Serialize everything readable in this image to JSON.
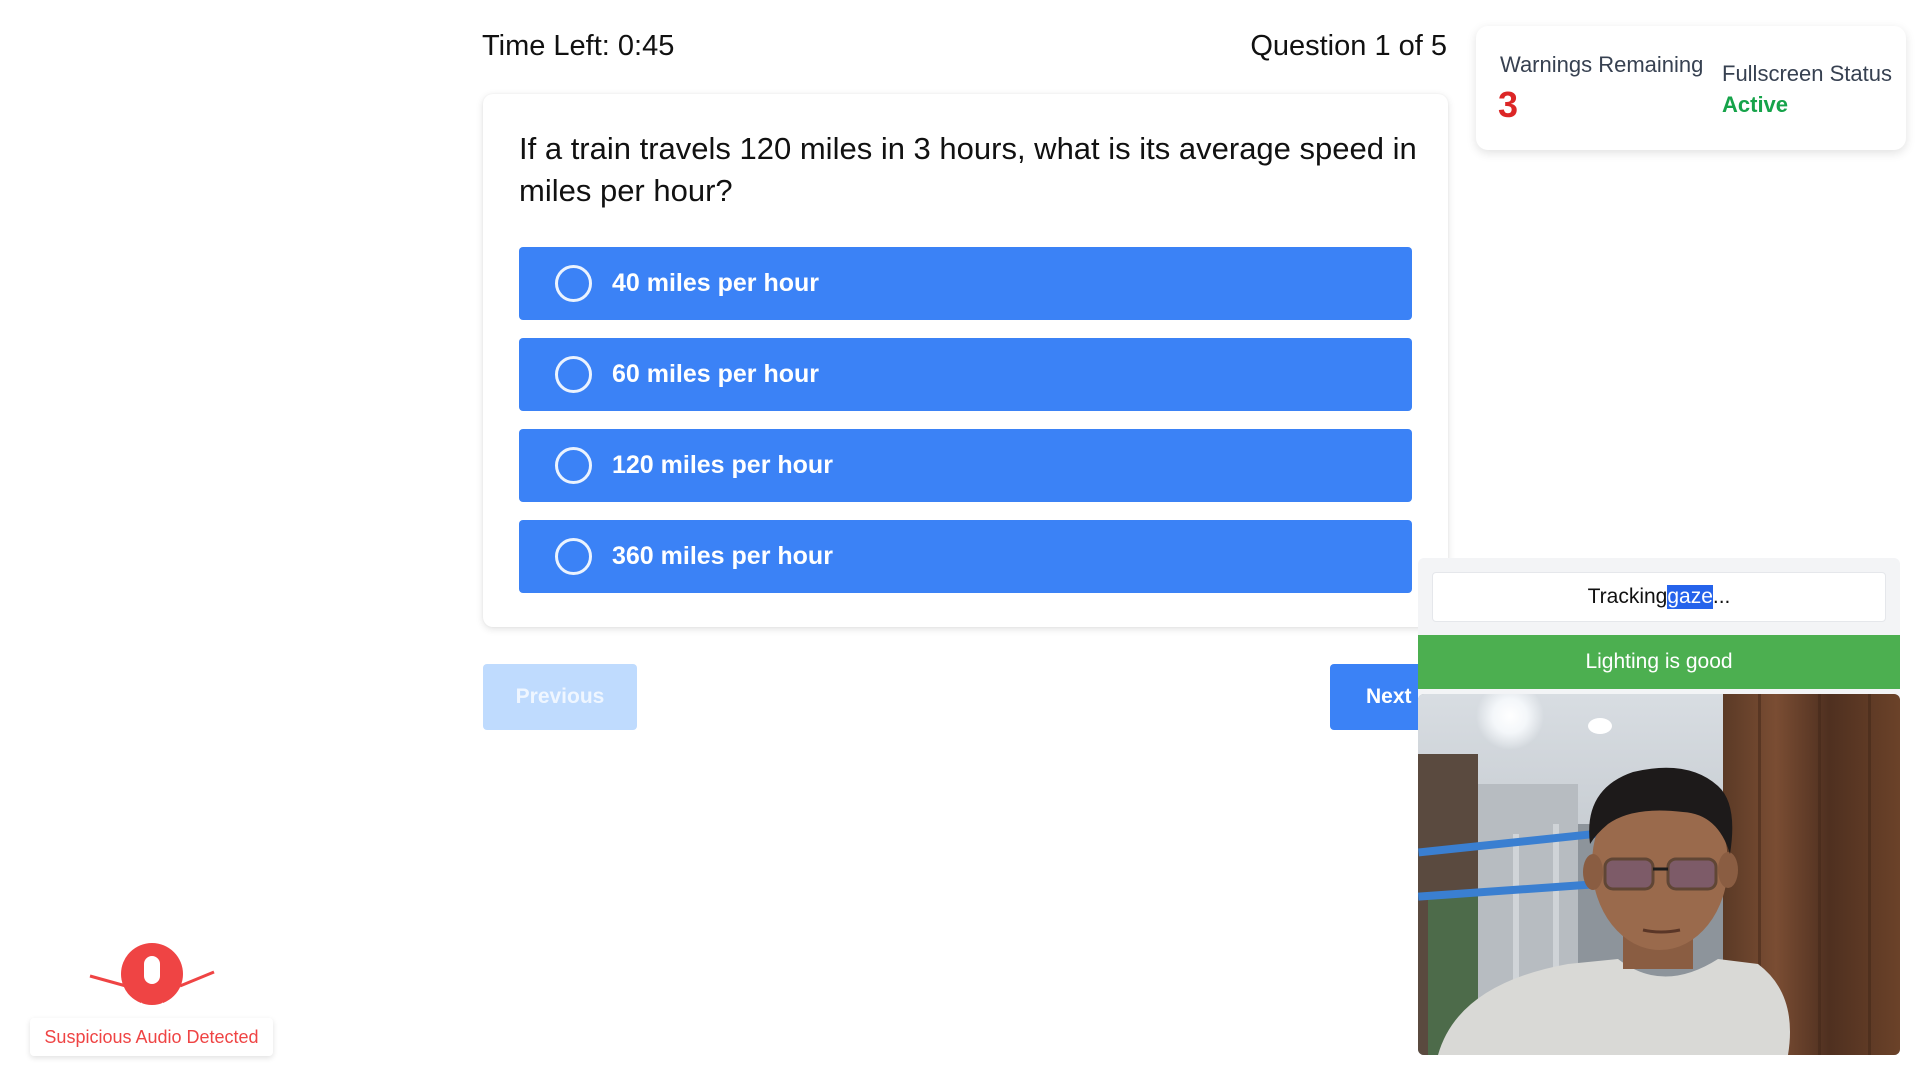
{
  "quiz": {
    "timer": "Time Left: 0:45",
    "counter": "Question 1 of 5",
    "question": "If a train travels 120 miles in 3 hours, what is its average speed in miles per hour?",
    "options": [
      {
        "label": "40 miles per hour"
      },
      {
        "label": "60 miles per hour"
      },
      {
        "label": "120 miles per hour"
      },
      {
        "label": "360 miles per hour"
      }
    ],
    "prev_label": "Previous",
    "next_label": "Next"
  },
  "status": {
    "warnings_label": "Warnings Remaining",
    "warnings_value": "3",
    "fullscreen_label": "Fullscreen Status",
    "fullscreen_value": "Active"
  },
  "monitor": {
    "tracking_prefix": "Tracking ",
    "tracking_highlight": "gaze",
    "tracking_suffix": "...",
    "lighting": "Lighting is good"
  },
  "alerts": {
    "audio": "Suspicious Audio Detected"
  },
  "colors": {
    "accent": "#3b82f6",
    "warning": "#dc2626",
    "success": "#16a34a",
    "lighting_bg": "#4caf50",
    "alert": "#ef4444"
  }
}
